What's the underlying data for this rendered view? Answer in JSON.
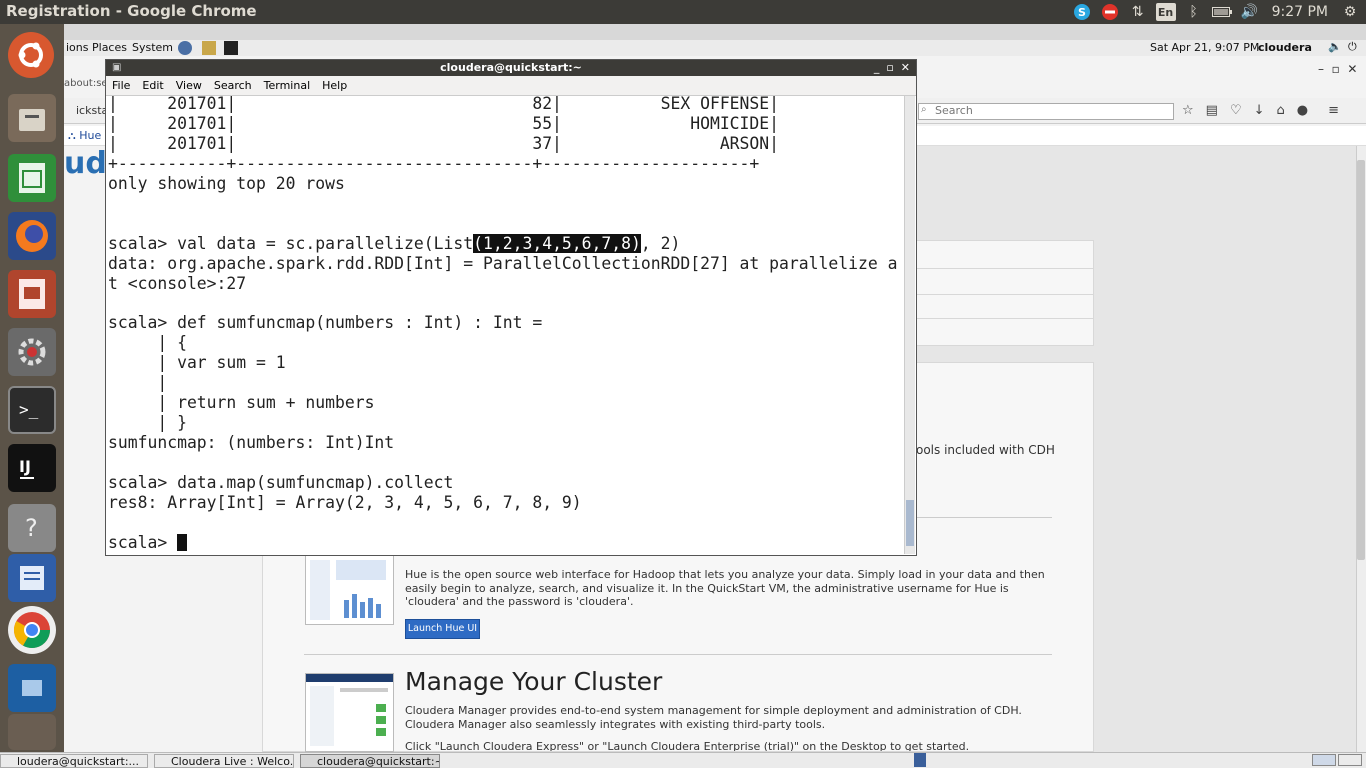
{
  "window_title": "Registration - Google Chrome",
  "tray": {
    "keyboard": "En",
    "clock": "9:27 PM"
  },
  "gnome_panel": {
    "menus": [
      "ions",
      "Places",
      "System"
    ],
    "datetime": "Sat Apr 21,  9:07 PM",
    "user": "cloudera"
  },
  "browser": {
    "tab_fragment": "about:sessionresto",
    "url_fragment": "ickstart.cl",
    "search_placeholder": "Search",
    "bookmark_hue": "Hue",
    "logo_fragment": "ude",
    "tools_text": "ools included with CDH",
    "hue_desc": "Hue is the open source web interface for Hadoop that lets you analyze your data. Simply load in your data and then easily begin to analyze, search, and visualize it. In the QuickStart VM, the administrative username for Hue is 'cloudera' and the password is 'cloudera'.",
    "launch_hue": "Launch Hue UI",
    "manage_title": "Manage Your Cluster",
    "manage_desc": "Cloudera Manager provides end-to-end system management for simple deployment and administration of CDH. Cloudera Manager also seamlessly integrates with existing third-party tools.",
    "manage_hint": "Click \"Launch Cloudera Express\" or \"Launch Cloudera Enterprise (trial)\" on the Desktop to get started."
  },
  "terminal": {
    "title": "cloudera@quickstart:~",
    "menu": [
      "File",
      "Edit",
      "View",
      "Search",
      "Terminal",
      "Help"
    ],
    "lines_before": "|     201701|                              82|          SEX OFFENSE|\n|     201701|                              55|             HOMICIDE|\n|     201701|                              37|                ARSON|\n+-----------+------------------------------+---------------------+\nonly showing top 20 rows\n\n\nscala> val data = sc.parallelize(List",
    "selection": "(1,2,3,4,5,6,7,8)",
    "lines_after": ", 2)\ndata: org.apache.spark.rdd.RDD[Int] = ParallelCollectionRDD[27] at parallelize a\nt <console>:27\n\nscala> def sumfuncmap(numbers : Int) : Int =\n     | {\n     | var sum = 1\n     |\n     | return sum + numbers\n     | }\nsumfuncmap: (numbers: Int)Int\n\nscala> data.map(sumfuncmap).collect\nres8: Array[Int] = Array(2, 3, 4, 5, 6, 7, 8, 9)\n\n",
    "prompt": "scala> "
  },
  "taskbar": [
    "loudera@quickstart:...",
    "Cloudera Live : Welco...",
    "cloudera@quickstart:~"
  ],
  "colors": {
    "panel": "#3c3b37",
    "launcher": "#5b5348",
    "hue_button": "#2e6bc4"
  }
}
